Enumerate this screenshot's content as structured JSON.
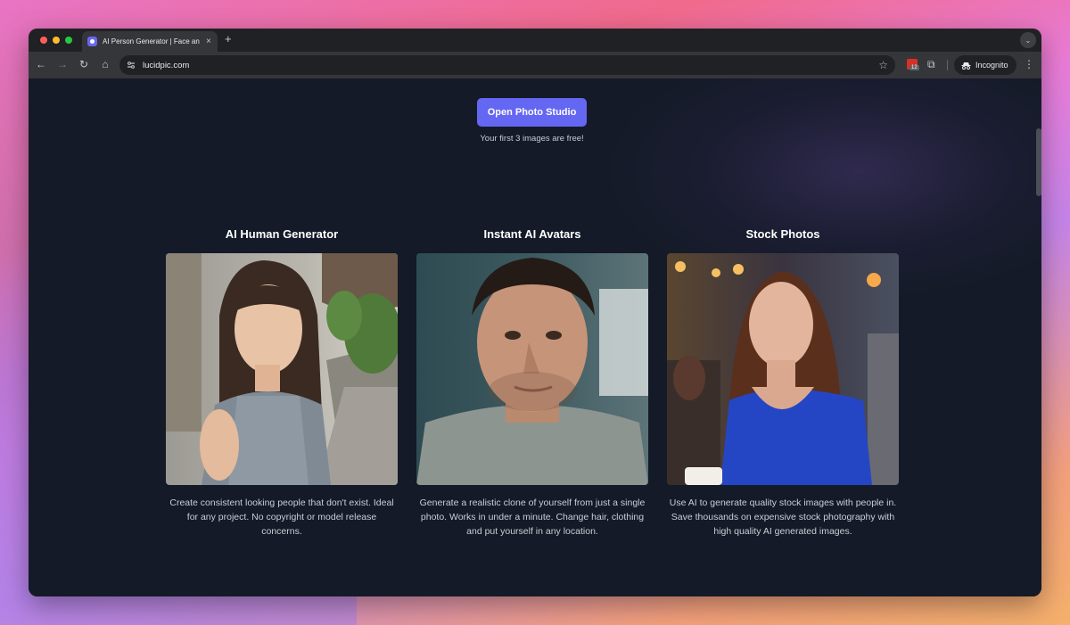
{
  "browser": {
    "tab_title": "AI Person Generator | Face an",
    "tab_close": "×",
    "new_tab": "+",
    "url": "lucidpic.com",
    "extension_badge": "12",
    "incognito_label": "Incognito",
    "icons": {
      "back": "←",
      "forward": "→",
      "reload": "↻",
      "home": "⌂",
      "star": "☆",
      "puzzle": "⧉",
      "menu": "⋮",
      "chevron": "⌄",
      "incognito": "👓"
    }
  },
  "hero": {
    "cta_label": "Open Photo Studio",
    "cta_subtext": "Your first 3 images are free!",
    "accent": "#6467f2"
  },
  "cards": [
    {
      "title": "AI Human Generator",
      "description": "Create consistent looking people that don't exist. Ideal for any project. No copyright or model release concerns."
    },
    {
      "title": "Instant AI Avatars",
      "description": "Generate a realistic clone of yourself from just a single photo. Works in under a minute. Change hair, clothing and put yourself in any location."
    },
    {
      "title": "Stock Photos",
      "description": "Use AI to generate quality stock images with people in. Save thousands on expensive stock photography with high quality AI generated images."
    }
  ]
}
